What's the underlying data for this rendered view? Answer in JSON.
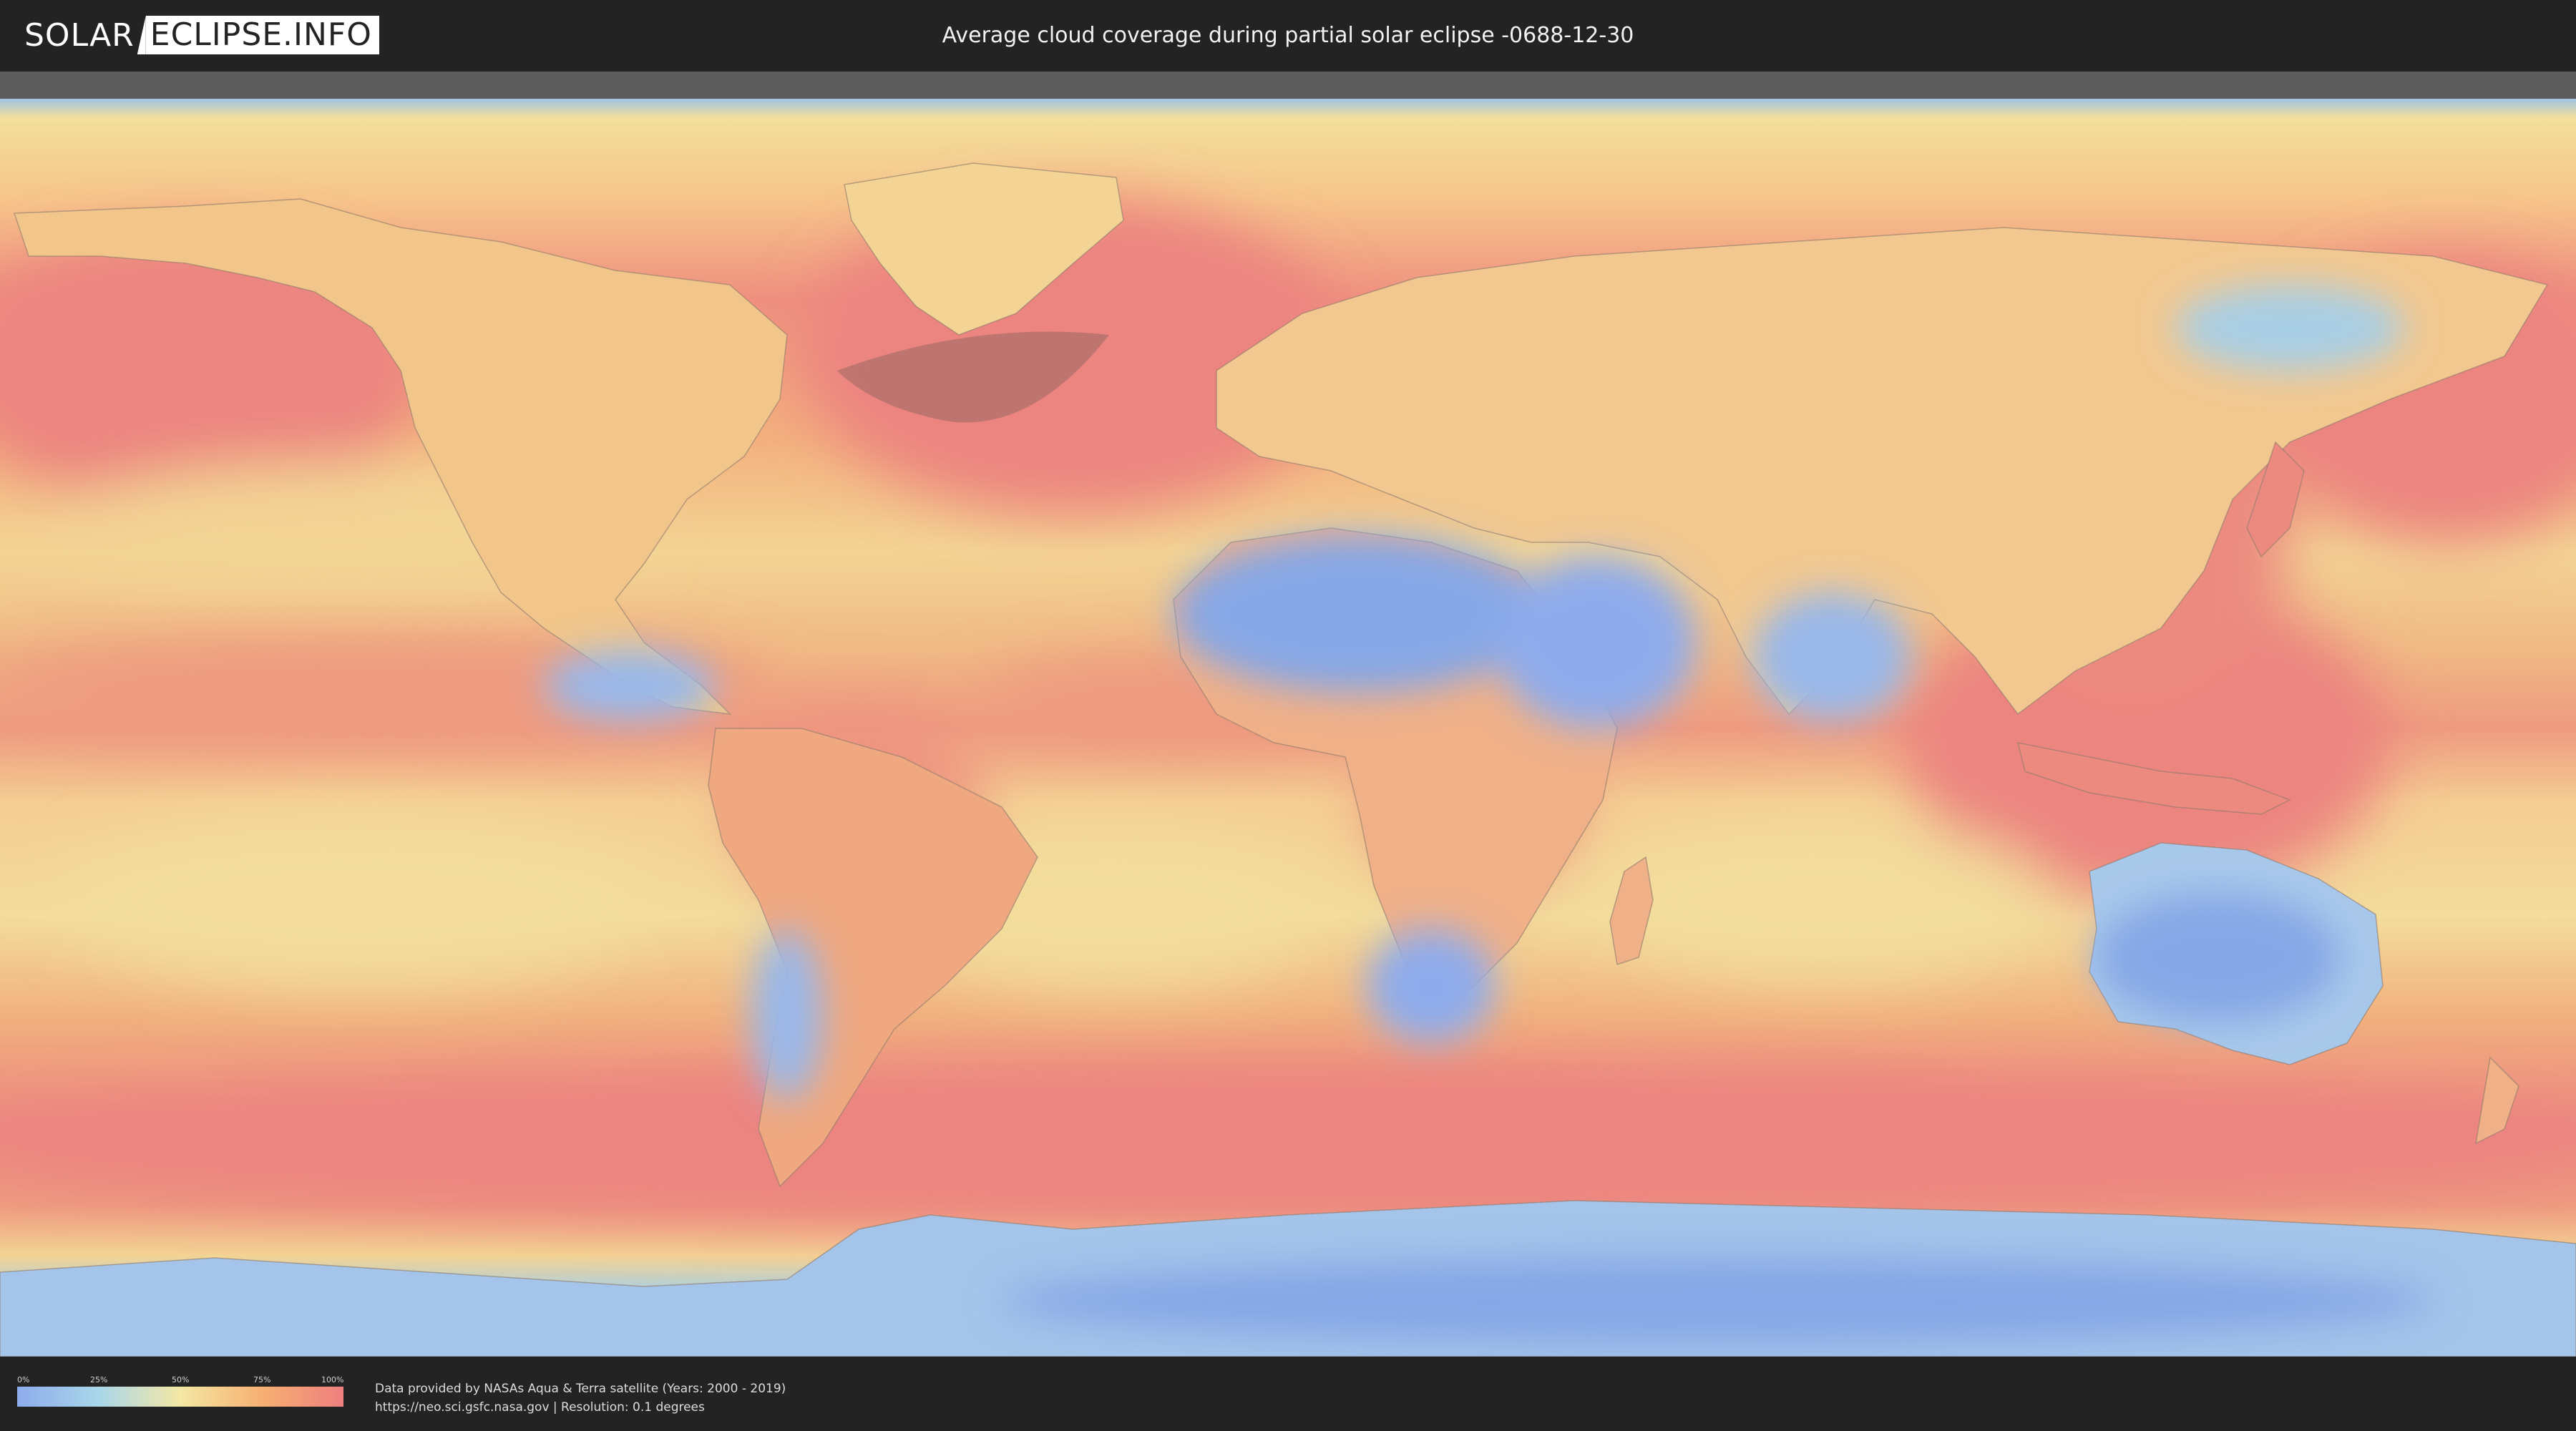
{
  "header": {
    "logo_part1": "SOLAR",
    "logo_part2": "ECLIPSE.INFO",
    "title": "Average cloud coverage during partial solar eclipse -0688-12-30"
  },
  "legend": {
    "ticks": [
      "0%",
      "25%",
      "50%",
      "75%",
      "100%"
    ],
    "tick_fractions": [
      0,
      0.25,
      0.5,
      0.75,
      1.0
    ],
    "colors": [
      "#8eacec",
      "#a9d6ea",
      "#f4e8a4",
      "#f6b072",
      "#ef7f7f"
    ]
  },
  "footer": {
    "line1": "Data provided by NASAs Aqua & Terra satellite (Years: 2000 - 2019)",
    "line2": "https://neo.sci.gsfc.nasa.gov | Resolution: 0.1 degrees"
  },
  "map": {
    "projection": "equirectangular",
    "colors": {
      "clear": "#86a7e6",
      "low": "#a8cfe6",
      "mid": "#f3df9c",
      "high": "#f4a97c",
      "cloudy": "#ec8480",
      "land_border": "#8c7a6a",
      "eclipse_shadow": "#6e5a50"
    }
  }
}
